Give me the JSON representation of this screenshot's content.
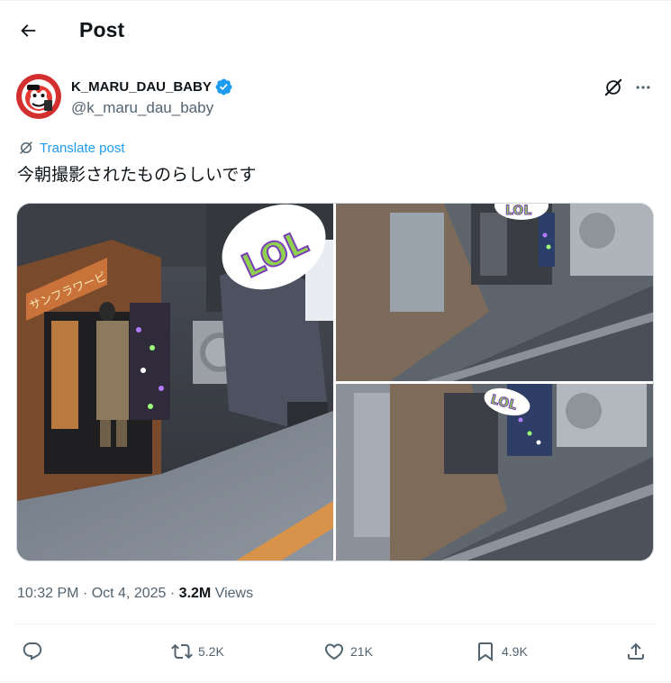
{
  "header": {
    "title": "Post"
  },
  "author": {
    "display_name": "K_MARU_DAU_BABY",
    "handle": "@k_maru_dau_baby",
    "verified": true
  },
  "translate_label": "Translate post",
  "post_text": "今朝撮影されたものらしいです",
  "media": {
    "count": 3,
    "photo1_sign": "サンフラワービ",
    "sticker_text": "LOL"
  },
  "meta": {
    "time": "10:32 PM",
    "date": "Oct 4, 2025",
    "views_count": "3.2M",
    "views_label": "Views"
  },
  "actions": {
    "replies": "",
    "reposts": "5.2K",
    "likes": "21K",
    "bookmarks": "4.9K"
  },
  "colors": {
    "accent": "#1d9bf0",
    "text": "#0f1419",
    "secondary": "#536471",
    "border": "#cfd9de"
  },
  "icons": [
    "back-arrow-icon",
    "verified-badge-icon",
    "grok-icon",
    "more-icon",
    "translate-icon",
    "reply-icon",
    "repost-icon",
    "like-icon",
    "bookmark-icon",
    "share-icon"
  ]
}
